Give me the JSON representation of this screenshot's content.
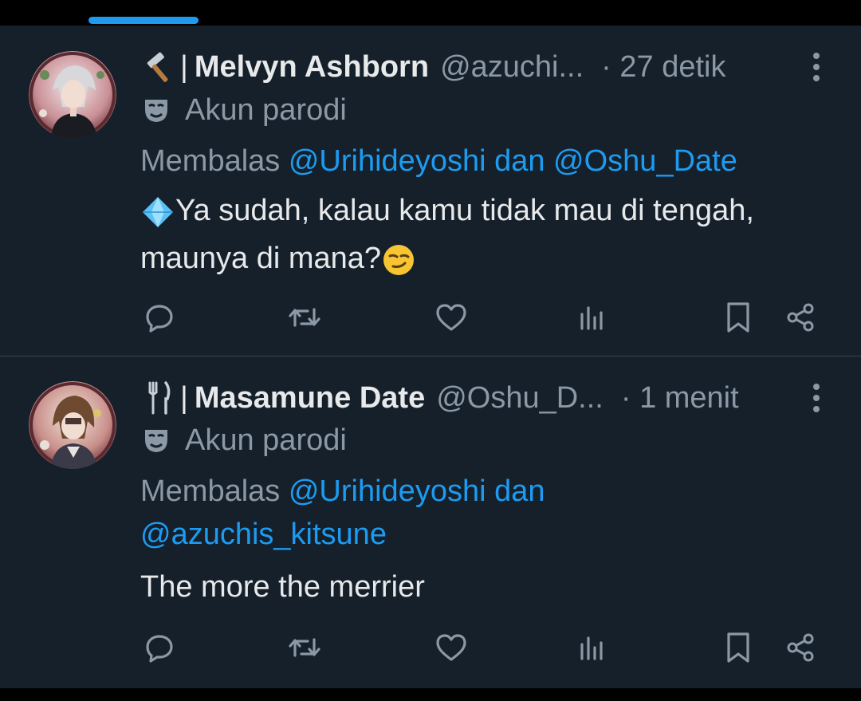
{
  "colors": {
    "background": "#15202b",
    "accent": "#1d9bf0",
    "text_primary": "#e7e9ea",
    "text_secondary": "#8b98a5",
    "divider": "#38444d"
  },
  "tweets": [
    {
      "name_icon": "hammer-icon",
      "separator": "|",
      "display_name": "Melvyn Ashborn",
      "handle": "@azuchi...",
      "time": "· 27 detik",
      "parody_label": "Akun parodi",
      "reply_prefix": "Membalas",
      "reply_mentions": "@Urihideyoshi dan @Oshu_Date",
      "text_lead_icon": "gem-icon",
      "text": "Ya sudah, kalau kamu tidak mau di tengah, maunya di mana?",
      "text_trail_icon": "smirk-emoji-icon"
    },
    {
      "name_icon": "fork-knife-icon",
      "separator": "|",
      "display_name": "Masamune Date",
      "handle": "@Oshu_D...",
      "time": "· 1 menit",
      "parody_label": "Akun parodi",
      "reply_prefix": "Membalas",
      "reply_mention_1": "@Urihideyoshi dan",
      "reply_mention_2": "@azuchis_kitsune",
      "text": "The more the merrier"
    }
  ]
}
